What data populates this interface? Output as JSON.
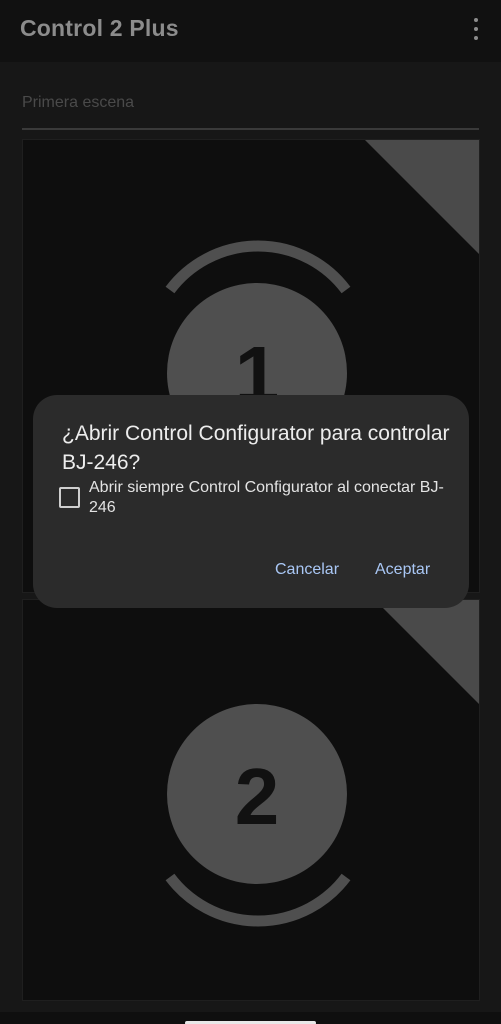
{
  "app_bar": {
    "title": "Control 2 Plus",
    "menu_icon": "more-vert-icon"
  },
  "scene": {
    "placeholder": "Primera escena"
  },
  "panels": [
    {
      "number": "1"
    },
    {
      "number": "2"
    }
  ],
  "dialog": {
    "title": "¿Abrir Control Configurator para controlar BJ-246?",
    "checkbox_label": "Abrir siempre Control Configurator al conectar BJ-246",
    "checkbox_checked": false,
    "cancel_label": "Cancelar",
    "accept_label": "Aceptar"
  },
  "colors": {
    "accent": "#a9c7f5",
    "dialog_bg": "#2b2b2b",
    "circle": "#4f4f4f"
  }
}
